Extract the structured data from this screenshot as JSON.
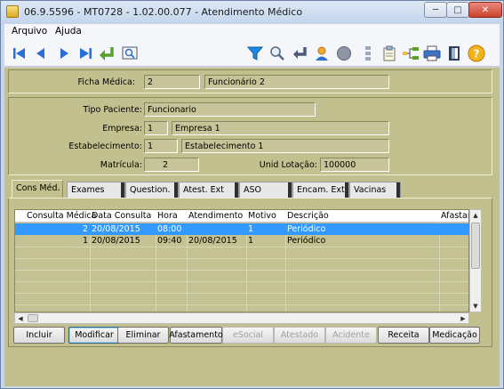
{
  "window": {
    "title": "06.9.5596 - MT0728 - 1.02.00.077 - Atendimento Médico",
    "minimize": "─",
    "maximize": "□",
    "close": "✕"
  },
  "menu": {
    "items": [
      "Arquivo",
      "Ajuda"
    ]
  },
  "toolbar": {
    "icons": [
      "first-record-icon",
      "prev-record-icon",
      "next-record-icon",
      "last-record-icon",
      "goto-icon",
      "zoom-icon",
      "filter-icon",
      "search-icon",
      "return-icon",
      "user-icon",
      "record-icon",
      "sort-icon",
      "clipboard-icon",
      "tree-icon",
      "print-icon",
      "exit-icon",
      "help-icon"
    ],
    "help_glyph": "?"
  },
  "header": {
    "ficha_medica_label": "Ficha Médica:",
    "ficha_medica_code": "2",
    "ficha_medica_name": "Funcionário 2"
  },
  "details": {
    "tipo_paciente_label": "Tipo Paciente:",
    "tipo_paciente": "Funcionario",
    "empresa_label": "Empresa:",
    "empresa_code": "1",
    "empresa_name": "Empresa 1",
    "estabelecimento_label": "Estabelecimento:",
    "estabelecimento_code": "1",
    "estabelecimento_name": "Estabelecimento 1",
    "matricula_label": "Matrícula:",
    "matricula": "2",
    "unid_lotacao_label": "Unid Lotação:",
    "unid_lotacao": "100000"
  },
  "tabs": [
    "Cons Méd.",
    "Exames",
    "Question.",
    "Atest. Ext",
    "ASO",
    "Encam. Ext",
    "Vacinas"
  ],
  "grid": {
    "columns": [
      "Consulta Médica",
      "Data Consulta",
      "Hora",
      "Atendimento",
      "Motivo",
      "Descrição",
      "Afastam"
    ],
    "rows": [
      [
        "2",
        "20/08/2015",
        "08:00",
        "",
        "1",
        "Periódico"
      ],
      [
        "1",
        "20/08/2015",
        "09:40",
        "20/08/2015",
        "1",
        "Periódico"
      ]
    ],
    "selected_row": 0
  },
  "buttons": {
    "incluir": "Incluir",
    "modificar": "Modificar",
    "eliminar": "Eliminar",
    "afastamento": "Afastamento",
    "esocial": "eSocial",
    "atestado": "Atestado",
    "acidente": "Acidente",
    "receita": "Receita",
    "medicacao": "Medicação"
  },
  "colors": {
    "panel_bg": "#c2c08e",
    "selection": "#3399ff",
    "window_frame": "#c9d6e8"
  }
}
